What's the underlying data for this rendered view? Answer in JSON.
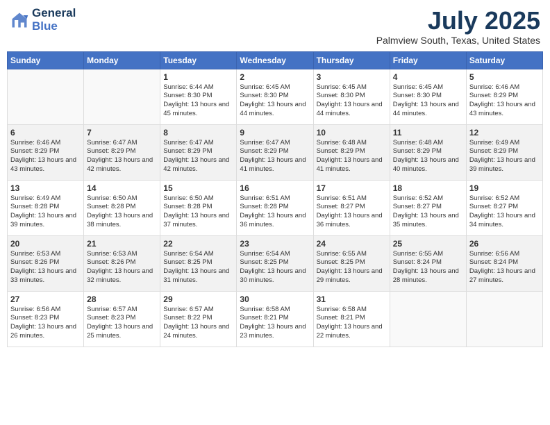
{
  "header": {
    "logo_line1": "General",
    "logo_line2": "Blue",
    "month_year": "July 2025",
    "location": "Palmview South, Texas, United States"
  },
  "days_of_week": [
    "Sunday",
    "Monday",
    "Tuesday",
    "Wednesday",
    "Thursday",
    "Friday",
    "Saturday"
  ],
  "weeks": [
    [
      {
        "day": "",
        "info": ""
      },
      {
        "day": "",
        "info": ""
      },
      {
        "day": "1",
        "info": "Sunrise: 6:44 AM\nSunset: 8:30 PM\nDaylight: 13 hours and 45 minutes."
      },
      {
        "day": "2",
        "info": "Sunrise: 6:45 AM\nSunset: 8:30 PM\nDaylight: 13 hours and 44 minutes."
      },
      {
        "day": "3",
        "info": "Sunrise: 6:45 AM\nSunset: 8:30 PM\nDaylight: 13 hours and 44 minutes."
      },
      {
        "day": "4",
        "info": "Sunrise: 6:45 AM\nSunset: 8:30 PM\nDaylight: 13 hours and 44 minutes."
      },
      {
        "day": "5",
        "info": "Sunrise: 6:46 AM\nSunset: 8:29 PM\nDaylight: 13 hours and 43 minutes."
      }
    ],
    [
      {
        "day": "6",
        "info": "Sunrise: 6:46 AM\nSunset: 8:29 PM\nDaylight: 13 hours and 43 minutes."
      },
      {
        "day": "7",
        "info": "Sunrise: 6:47 AM\nSunset: 8:29 PM\nDaylight: 13 hours and 42 minutes."
      },
      {
        "day": "8",
        "info": "Sunrise: 6:47 AM\nSunset: 8:29 PM\nDaylight: 13 hours and 42 minutes."
      },
      {
        "day": "9",
        "info": "Sunrise: 6:47 AM\nSunset: 8:29 PM\nDaylight: 13 hours and 41 minutes."
      },
      {
        "day": "10",
        "info": "Sunrise: 6:48 AM\nSunset: 8:29 PM\nDaylight: 13 hours and 41 minutes."
      },
      {
        "day": "11",
        "info": "Sunrise: 6:48 AM\nSunset: 8:29 PM\nDaylight: 13 hours and 40 minutes."
      },
      {
        "day": "12",
        "info": "Sunrise: 6:49 AM\nSunset: 8:29 PM\nDaylight: 13 hours and 39 minutes."
      }
    ],
    [
      {
        "day": "13",
        "info": "Sunrise: 6:49 AM\nSunset: 8:28 PM\nDaylight: 13 hours and 39 minutes."
      },
      {
        "day": "14",
        "info": "Sunrise: 6:50 AM\nSunset: 8:28 PM\nDaylight: 13 hours and 38 minutes."
      },
      {
        "day": "15",
        "info": "Sunrise: 6:50 AM\nSunset: 8:28 PM\nDaylight: 13 hours and 37 minutes."
      },
      {
        "day": "16",
        "info": "Sunrise: 6:51 AM\nSunset: 8:28 PM\nDaylight: 13 hours and 36 minutes."
      },
      {
        "day": "17",
        "info": "Sunrise: 6:51 AM\nSunset: 8:27 PM\nDaylight: 13 hours and 36 minutes."
      },
      {
        "day": "18",
        "info": "Sunrise: 6:52 AM\nSunset: 8:27 PM\nDaylight: 13 hours and 35 minutes."
      },
      {
        "day": "19",
        "info": "Sunrise: 6:52 AM\nSunset: 8:27 PM\nDaylight: 13 hours and 34 minutes."
      }
    ],
    [
      {
        "day": "20",
        "info": "Sunrise: 6:53 AM\nSunset: 8:26 PM\nDaylight: 13 hours and 33 minutes."
      },
      {
        "day": "21",
        "info": "Sunrise: 6:53 AM\nSunset: 8:26 PM\nDaylight: 13 hours and 32 minutes."
      },
      {
        "day": "22",
        "info": "Sunrise: 6:54 AM\nSunset: 8:25 PM\nDaylight: 13 hours and 31 minutes."
      },
      {
        "day": "23",
        "info": "Sunrise: 6:54 AM\nSunset: 8:25 PM\nDaylight: 13 hours and 30 minutes."
      },
      {
        "day": "24",
        "info": "Sunrise: 6:55 AM\nSunset: 8:25 PM\nDaylight: 13 hours and 29 minutes."
      },
      {
        "day": "25",
        "info": "Sunrise: 6:55 AM\nSunset: 8:24 PM\nDaylight: 13 hours and 28 minutes."
      },
      {
        "day": "26",
        "info": "Sunrise: 6:56 AM\nSunset: 8:24 PM\nDaylight: 13 hours and 27 minutes."
      }
    ],
    [
      {
        "day": "27",
        "info": "Sunrise: 6:56 AM\nSunset: 8:23 PM\nDaylight: 13 hours and 26 minutes."
      },
      {
        "day": "28",
        "info": "Sunrise: 6:57 AM\nSunset: 8:23 PM\nDaylight: 13 hours and 25 minutes."
      },
      {
        "day": "29",
        "info": "Sunrise: 6:57 AM\nSunset: 8:22 PM\nDaylight: 13 hours and 24 minutes."
      },
      {
        "day": "30",
        "info": "Sunrise: 6:58 AM\nSunset: 8:21 PM\nDaylight: 13 hours and 23 minutes."
      },
      {
        "day": "31",
        "info": "Sunrise: 6:58 AM\nSunset: 8:21 PM\nDaylight: 13 hours and 22 minutes."
      },
      {
        "day": "",
        "info": ""
      },
      {
        "day": "",
        "info": ""
      }
    ]
  ]
}
